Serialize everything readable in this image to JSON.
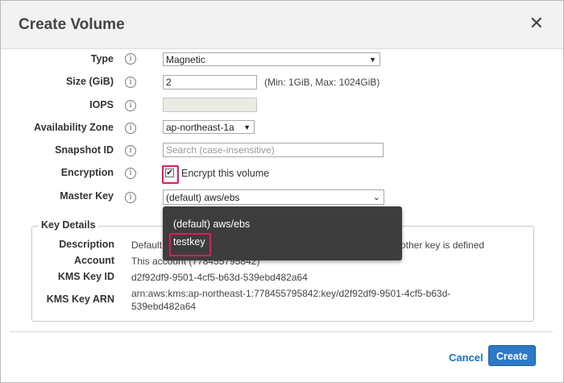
{
  "dialog": {
    "title": "Create Volume"
  },
  "form": {
    "type_label": "Type",
    "type_value": "Magnetic",
    "size_label": "Size (GiB)",
    "size_value": "2",
    "size_hint": "(Min: 1GiB, Max: 1024GiB)",
    "iops_label": "IOPS",
    "az_label": "Availability Zone",
    "az_value": "ap-northeast-1a",
    "snapshot_label": "Snapshot ID",
    "snapshot_placeholder": "Search (case-insensitive)",
    "encryption_label": "Encryption",
    "encrypt_text": "Encrypt this volume",
    "master_key_label": "Master Key",
    "master_key_value": "(default) aws/ebs"
  },
  "dropdown": {
    "options": [
      "(default) aws/ebs",
      "testkey"
    ]
  },
  "key_details": {
    "legend": "Key Details",
    "description_label": "Description",
    "description_value_start": "Default",
    "description_value_end": "other key is defined",
    "account_label": "Account",
    "account_value": "This account (778455795842)",
    "kms_id_label": "KMS Key ID",
    "kms_id_value": "d2f92df9-9501-4cf5-b63d-539ebd482a64",
    "kms_arn_label": "KMS Key ARN",
    "kms_arn_line1": "arn:aws:kms:ap-northeast-1:778455795842:key/d2f92df9-9501-4cf5-b63d-",
    "kms_arn_line2": "539ebd482a64"
  },
  "footer": {
    "cancel_label": "Cancel",
    "create_label": "Create"
  },
  "colors": {
    "primary": "#2c79c7",
    "highlight": "#e3195a",
    "link": "#1f6ebf"
  },
  "icons": {
    "info": "info-icon",
    "close": "close-icon",
    "dropdown": "chevron-down-icon"
  }
}
